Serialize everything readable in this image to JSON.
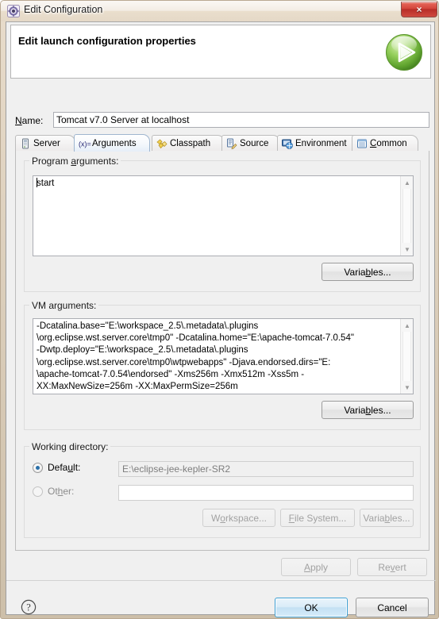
{
  "window": {
    "title": "Edit Configuration",
    "title_icon": "eclipse-config-icon",
    "close_label": "×"
  },
  "header": {
    "title": "Edit launch configuration properties",
    "icon": "run-play-icon"
  },
  "name_row": {
    "label_prefix": "N",
    "label_rest": "ame:",
    "value": "Tomcat v7.0 Server at localhost",
    "placeholder": ""
  },
  "tabs": [
    {
      "label": "Server",
      "icon": "server-icon",
      "active": false,
      "accel": ""
    },
    {
      "label": "Arguments",
      "icon": "arguments-variable-icon",
      "active": true,
      "accel": ""
    },
    {
      "label": "Classpath",
      "icon": "classpath-icon",
      "active": false,
      "accel": ""
    },
    {
      "label": "Source",
      "icon": "source-icon",
      "active": false,
      "accel": ""
    },
    {
      "label": "Environment",
      "icon": "environment-icon",
      "active": false,
      "accel": ""
    },
    {
      "label": "Common",
      "icon": "common-icon",
      "active": false,
      "accel": "C"
    }
  ],
  "program_args": {
    "group_title_a": "Program ",
    "group_title_b": "a",
    "group_title_c": "rguments:",
    "value": "start",
    "variables_button": {
      "pre": "Varia",
      "accel": "b",
      "post": "les..."
    }
  },
  "vm_args": {
    "group_title": "VM arguments:",
    "lines": [
      "-Dcatalina.base=\"E:\\workspace_2.5\\.metadata\\.plugins",
      "\\org.eclipse.wst.server.core\\tmp0\" -Dcatalina.home=\"E:\\apache-tomcat-7.0.54\"",
      "-Dwtp.deploy=\"E:\\workspace_2.5\\.metadata\\.plugins",
      "\\org.eclipse.wst.server.core\\tmp0\\wtpwebapps\" -Djava.endorsed.dirs=\"E:",
      "\\apache-tomcat-7.0.54\\endorsed\" -Xms256m -Xmx512m -Xss5m -",
      "XX:MaxNewSize=256m -XX:MaxPermSize=256m"
    ],
    "variables_button": {
      "pre": "Varia",
      "accel": "b",
      "post": "les..."
    }
  },
  "working_directory": {
    "group_title": "Working directory:",
    "default_radio": {
      "pre": "Defa",
      "accel": "u",
      "post": "lt:",
      "checked": true
    },
    "default_value": "E:\\eclipse-jee-kepler-SR2",
    "other_radio": {
      "pre": "Ot",
      "accel": "h",
      "post": "er:",
      "checked": false
    },
    "other_value": "",
    "buttons": [
      {
        "pre": "W",
        "accel": "o",
        "post": "rkspace...",
        "disabled": true
      },
      {
        "pre": "",
        "accel": "F",
        "post": "ile System...",
        "disabled": true
      },
      {
        "pre": "Varia",
        "accel": "b",
        "post": "les...",
        "disabled": true
      }
    ]
  },
  "tab_footer_buttons": [
    {
      "pre": "",
      "accel": "A",
      "post": "pply",
      "disabled": true
    },
    {
      "pre": "Re",
      "accel": "v",
      "post": "ert",
      "disabled": true
    }
  ],
  "dialog_buttons": [
    {
      "label": "OK",
      "primary": true
    },
    {
      "label": "Cancel",
      "primary": false
    }
  ],
  "help": {
    "icon": "help-question-icon"
  },
  "colors": {
    "frame": "#ddd0bd",
    "close_red": "#d2433a",
    "accent_blue": "#3c9fd4",
    "run_green": "#6cbb3c",
    "dialog_bg": "#f0f0f0"
  }
}
